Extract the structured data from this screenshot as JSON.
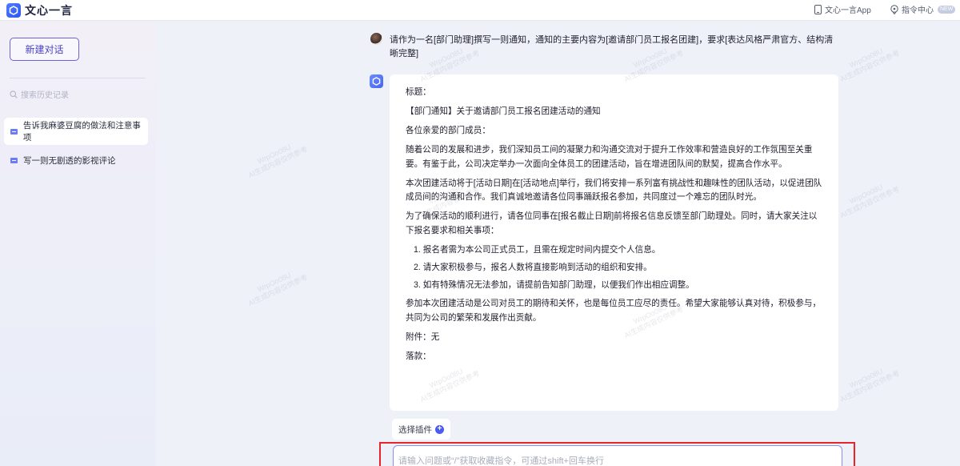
{
  "header": {
    "app_name": "文心一言",
    "app_link": "文心一言App",
    "command_center": "指令中心",
    "new_badge": "NEW"
  },
  "sidebar": {
    "new_chat": "新建对话",
    "search_placeholder": "搜索历史记录",
    "history": [
      {
        "label": "告诉我麻婆豆腐的做法和注意事项",
        "active": true
      },
      {
        "label": "写一则无剧透的影视评论",
        "active": false
      }
    ]
  },
  "conversation": {
    "user_message": "请作为一名[部门助理]撰写一则通知，通知的主要内容为[邀请部门员工报名团建]，要求[表达风格严肃官方、结构清晰完整]",
    "answer": {
      "p1": "标题：",
      "p2": "【部门通知】关于邀请部门员工报名团建活动的通知",
      "p3": "各位亲爱的部门成员：",
      "p4": "随着公司的发展和进步，我们深知员工间的凝聚力和沟通交流对于提升工作效率和营造良好的工作氛围至关重要。有鉴于此，公司决定举办一次面向全体员工的团建活动，旨在增进团队间的默契，提高合作水平。",
      "p5": "本次团建活动将于[活动日期]在[活动地点]举行，我们将安排一系列富有挑战性和趣味性的团队活动，以促进团队成员间的沟通和合作。我们真诚地邀请各位同事踊跃报名参加，共同度过一个难忘的团队时光。",
      "p6": "为了确保活动的顺利进行，请各位同事在[报名截止日期]前将报名信息反馈至部门助理处。同时，请大家关注以下报名要求和相关事项：",
      "list": [
        "1. 报名者需为本公司正式员工，且需在规定时间内提交个人信息。",
        "2. 请大家积极参与，报名人数将直接影响到活动的组织和安排。",
        "3. 如有特殊情况无法参加，请提前告知部门助理，以便我们作出相应调整。"
      ],
      "p7": "参加本次团建活动是公司对员工的期待和关怀，也是每位员工应尽的责任。希望大家能够认真对待，积极参与，共同为公司的繁荣和发展作出贡献。",
      "p8": "附件：无",
      "p9": "落款："
    }
  },
  "composer": {
    "plugin_label": "选择插件",
    "input_placeholder": "请输入问题或“/”获取收藏指令，可通过shift+回车换行"
  },
  "watermark": {
    "line1": "WrpOo08U",
    "line2": "AI生成内容仅供参考"
  },
  "colors": {
    "accent": "#4b43c9",
    "brand_blue": "#4a5cf0",
    "highlight_red": "#e6262b"
  }
}
